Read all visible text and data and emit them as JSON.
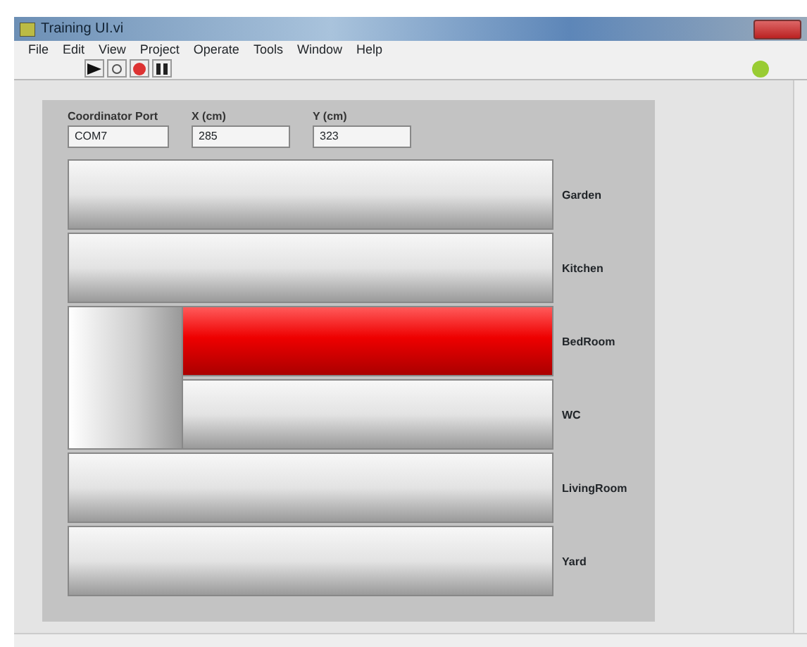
{
  "window": {
    "title": "Training UI.vi"
  },
  "menu": [
    "File",
    "Edit",
    "View",
    "Project",
    "Operate",
    "Tools",
    "Window",
    "Help"
  ],
  "inputs": [
    {
      "label": "Coordinator Port",
      "value": "COM7",
      "kind": "port"
    },
    {
      "label": "X (cm)",
      "value": "285",
      "kind": "numeric"
    },
    {
      "label": "Y (cm)",
      "value": "323",
      "kind": "numeric"
    }
  ],
  "rooms": [
    {
      "name": "Garden",
      "active": false
    },
    {
      "name": "Kitchen",
      "active": false
    },
    {
      "name": "BedRoom",
      "active": true
    },
    {
      "name": "WC",
      "active": false
    },
    {
      "name": "LivingRoom",
      "active": false
    },
    {
      "name": "Yard",
      "active": false
    }
  ]
}
